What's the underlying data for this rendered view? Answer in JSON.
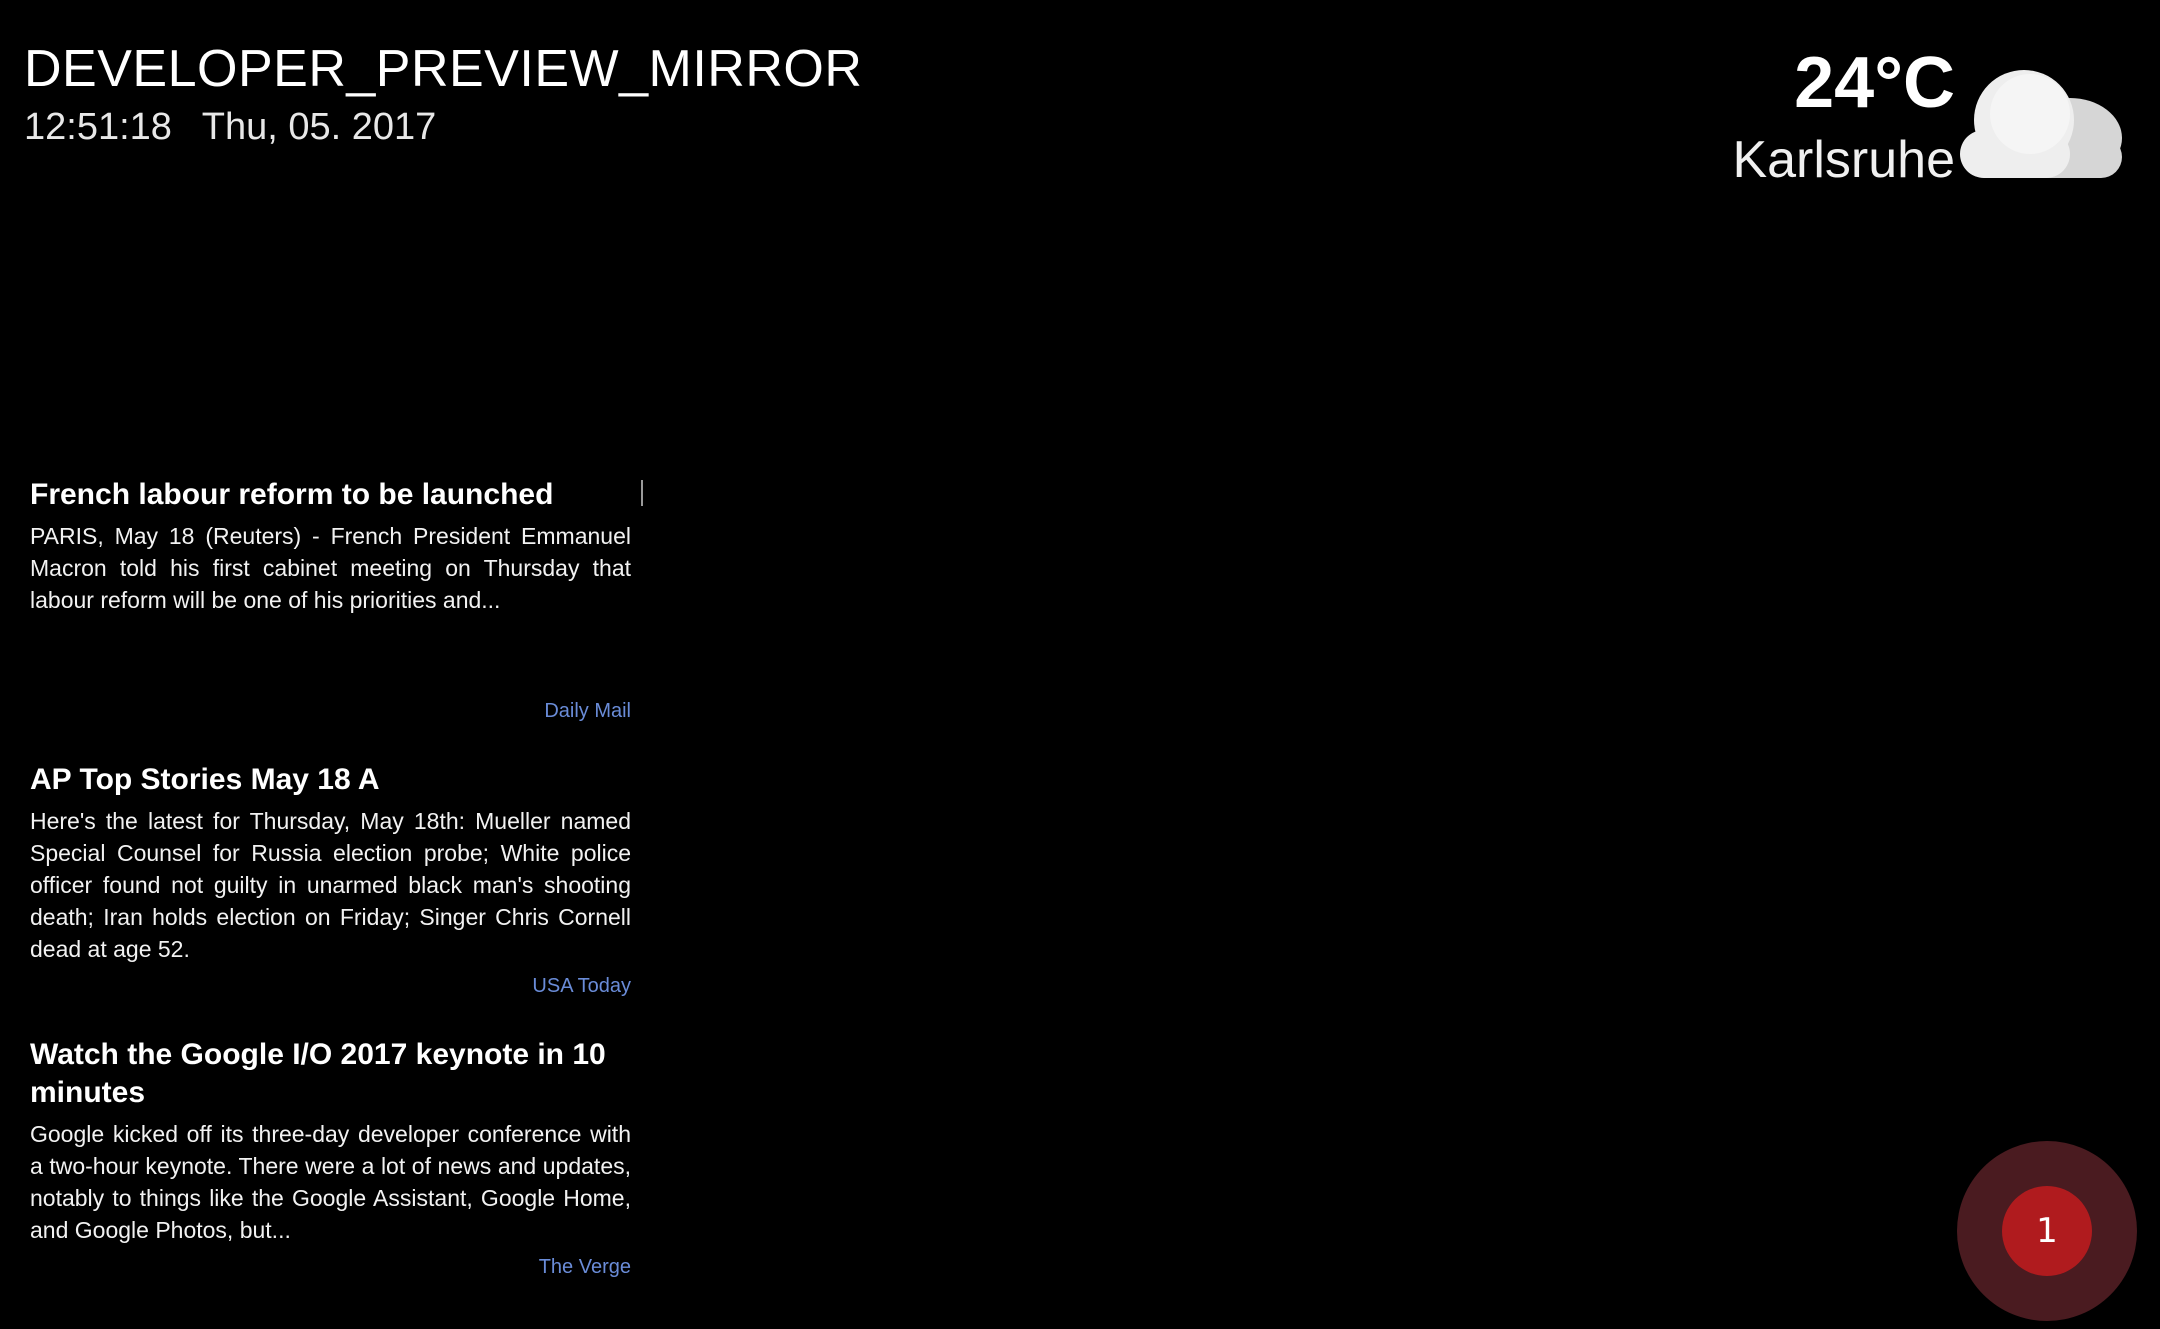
{
  "header": {
    "title": "DEVELOPER_PREVIEW_MIRROR",
    "time": "12:51:18",
    "date": "Thu, 05. 2017"
  },
  "weather": {
    "temperature": "24°C",
    "city": "Karlsruhe",
    "icon": "cloud-icon"
  },
  "news": [
    {
      "headline": "French labour reform to be launched",
      "summary": "PARIS, May 18 (Reuters) - French President Emmanuel Macron  told his first cabinet meeting on Thursday that labour reform  will be one of his priorities and...",
      "source": "Daily Mail"
    },
    {
      "headline": "AP Top Stories May 18 A",
      "summary": "Here's the latest for Thursday, May 18th: Mueller named Special Counsel for Russia election probe; White police officer found not guilty in unarmed black man's shooting death; Iran holds election on Friday; Singer Chris Cornell dead at age 52.",
      "source": "USA Today"
    },
    {
      "headline": "Watch the Google I/O 2017 keynote in 10 minutes",
      "summary": "Google kicked off its three-day developer conference with a two-hour keynote. There were a lot of news and updates, notably to things like the Google Assistant, Google Home, and Google Photos, but...",
      "source": "The Verge"
    }
  ],
  "notification": {
    "count": "1"
  },
  "colors": {
    "background": "#000000",
    "source_link": "#6a8cd8",
    "badge_outer": "#4a1b20",
    "badge_inner": "#b01b1e"
  }
}
